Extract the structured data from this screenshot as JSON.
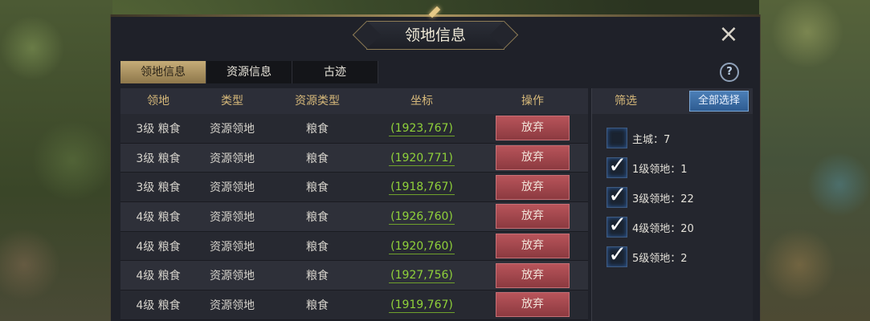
{
  "window": {
    "title": "领地信息",
    "close_icon": "×",
    "help_icon": "?"
  },
  "tabs": [
    {
      "label": "领地信息",
      "active": true
    },
    {
      "label": "资源信息",
      "active": false
    },
    {
      "label": "古迹",
      "active": false
    }
  ],
  "table": {
    "headers": [
      "领地",
      "类型",
      "资源类型",
      "坐标",
      "操作"
    ],
    "rows": [
      {
        "territory": "3级  粮食",
        "type": "资源领地",
        "resource": "粮食",
        "coord": "(1923,767)",
        "action": "放弃"
      },
      {
        "territory": "3级  粮食",
        "type": "资源领地",
        "resource": "粮食",
        "coord": "(1920,771)",
        "action": "放弃"
      },
      {
        "territory": "3级  粮食",
        "type": "资源领地",
        "resource": "粮食",
        "coord": "(1918,767)",
        "action": "放弃"
      },
      {
        "territory": "4级  粮食",
        "type": "资源领地",
        "resource": "粮食",
        "coord": "(1926,760)",
        "action": "放弃"
      },
      {
        "territory": "4级  粮食",
        "type": "资源领地",
        "resource": "粮食",
        "coord": "(1920,760)",
        "action": "放弃"
      },
      {
        "territory": "4级  粮食",
        "type": "资源领地",
        "resource": "粮食",
        "coord": "(1927,756)",
        "action": "放弃"
      },
      {
        "territory": "4级  粮食",
        "type": "资源领地",
        "resource": "粮食",
        "coord": "(1919,767)",
        "action": "放弃"
      }
    ]
  },
  "filter": {
    "title": "筛选",
    "select_all": "全部选择",
    "items": [
      {
        "label": "主城：7",
        "checked": false
      },
      {
        "label": "1级领地：1",
        "checked": true
      },
      {
        "label": "3级领地：22",
        "checked": true
      },
      {
        "label": "4级领地：20",
        "checked": true
      },
      {
        "label": "5级领地：2",
        "checked": true
      }
    ]
  },
  "colors": {
    "accent_gold": "#d7b97a",
    "coord_green": "#8fd13a",
    "abandon_red": "#a8464c",
    "select_blue": "#3d6ea5"
  }
}
